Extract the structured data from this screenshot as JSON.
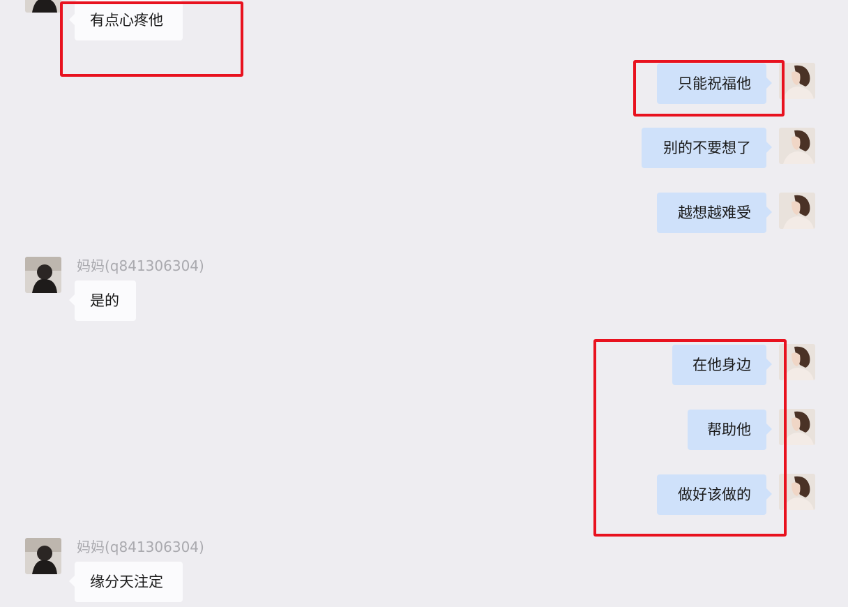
{
  "colors": {
    "background": "#eeedf1",
    "incoming_bubble": "#fbfbfd",
    "outgoing_bubble": "#cfe1fa",
    "highlight_border": "#e8121f",
    "sender_name": "#a9a9ae"
  },
  "messages": [
    {
      "direction": "incoming",
      "sender": "",
      "text": "有点心疼他",
      "highlighted": true
    },
    {
      "direction": "outgoing",
      "text": "只能祝福他",
      "highlighted": true
    },
    {
      "direction": "outgoing",
      "text": "别的不要想了",
      "highlighted": false
    },
    {
      "direction": "outgoing",
      "text": "越想越难受",
      "highlighted": false
    },
    {
      "direction": "incoming",
      "sender": "妈妈(q841306304)",
      "text": "是的",
      "highlighted": false
    },
    {
      "direction": "outgoing",
      "text": "在他身边",
      "highlighted": true
    },
    {
      "direction": "outgoing",
      "text": "帮助他",
      "highlighted": true
    },
    {
      "direction": "outgoing",
      "text": "做好该做的",
      "highlighted": true
    },
    {
      "direction": "incoming",
      "sender": "妈妈(q841306304)",
      "text": "缘分天注定",
      "highlighted": false
    }
  ],
  "icons": {
    "contact_avatar": "contact-avatar-icon",
    "self_avatar": "self-avatar-icon"
  }
}
